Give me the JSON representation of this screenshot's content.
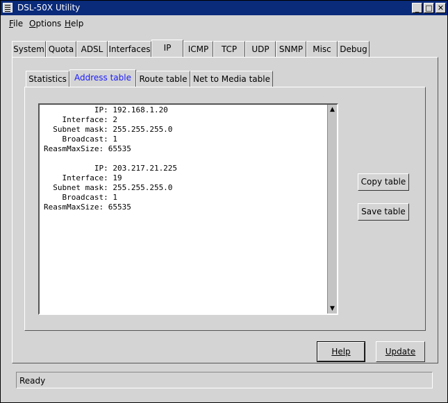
{
  "window": {
    "title": "DSL-50X Utility"
  },
  "menu": [
    {
      "label": "File",
      "underline": "F",
      "rest": "ile"
    },
    {
      "label": "Options",
      "underline": "O",
      "rest": "ptions"
    },
    {
      "label": "Help",
      "underline": "H",
      "rest": "elp"
    }
  ],
  "main_tabs": [
    "System",
    "Quota",
    "ADSL",
    "Interfaces",
    "IP",
    "ICMP",
    "TCP",
    "UDP",
    "SNMP",
    "Misc",
    "Debug"
  ],
  "active_main_tab": "IP",
  "sub_tabs": [
    "Statistics",
    "Address table",
    "Route table",
    "Net to Media table"
  ],
  "active_sub_tab": "Address table",
  "address_table_text": "           IP: 192.168.1.20\n    Interface: 2\n  Subnet mask: 255.255.255.0\n    Broadcast: 1\nReasmMaxSize: 65535\n\n           IP: 203.217.21.225\n    Interface: 19\n  Subnet mask: 255.255.255.0\n    Broadcast: 1\nReasmMaxSize: 65535",
  "buttons": {
    "copy_table": "Copy table",
    "save_table": "Save table",
    "help": "Help",
    "update": "Update"
  },
  "status_text": "Ready",
  "colors": {
    "titlebar": "#0a2a7a",
    "active_subtab_text": "#1a1aff"
  }
}
